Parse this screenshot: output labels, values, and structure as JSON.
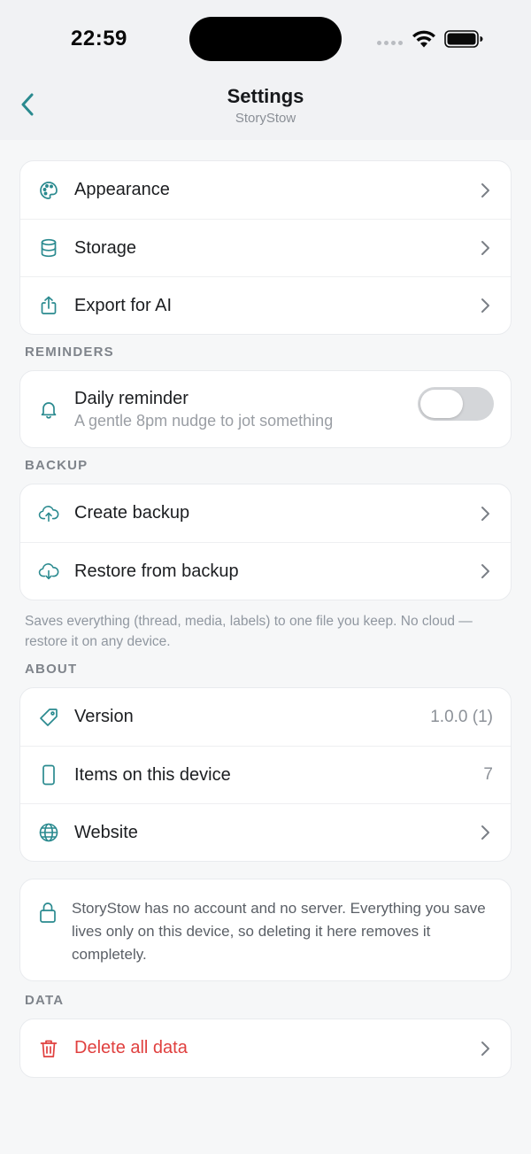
{
  "status_bar": {
    "time": "22:59"
  },
  "header": {
    "title": "Settings",
    "subtitle": "StoryStow"
  },
  "general": [
    {
      "label": "Appearance",
      "icon": "palette-icon"
    },
    {
      "label": "Storage",
      "icon": "database-icon"
    },
    {
      "label": "Export for AI",
      "icon": "share-icon"
    }
  ],
  "reminders": {
    "heading": "REMINDERS",
    "daily_label": "Daily reminder",
    "daily_desc": "A gentle 8pm nudge to jot something",
    "enabled": false
  },
  "backup": {
    "heading": "BACKUP",
    "create_label": "Create backup",
    "restore_label": "Restore from backup",
    "note": "Saves everything (thread, media, labels) to one file you keep. No cloud — restore it on any device."
  },
  "about": {
    "heading": "ABOUT",
    "version_label": "Version",
    "version_value": "1.0.0 (1)",
    "items_label": "Items on this device",
    "items_value": "7",
    "website_label": "Website"
  },
  "privacy_text": "StoryStow has no account and no server. Everything you save lives only on this device, so deleting it here removes it completely.",
  "data": {
    "heading": "DATA",
    "delete_label": "Delete all data"
  },
  "colors": {
    "accent": "#2a8a8f",
    "danger": "#e0403f",
    "background": "#f6f7f8"
  }
}
